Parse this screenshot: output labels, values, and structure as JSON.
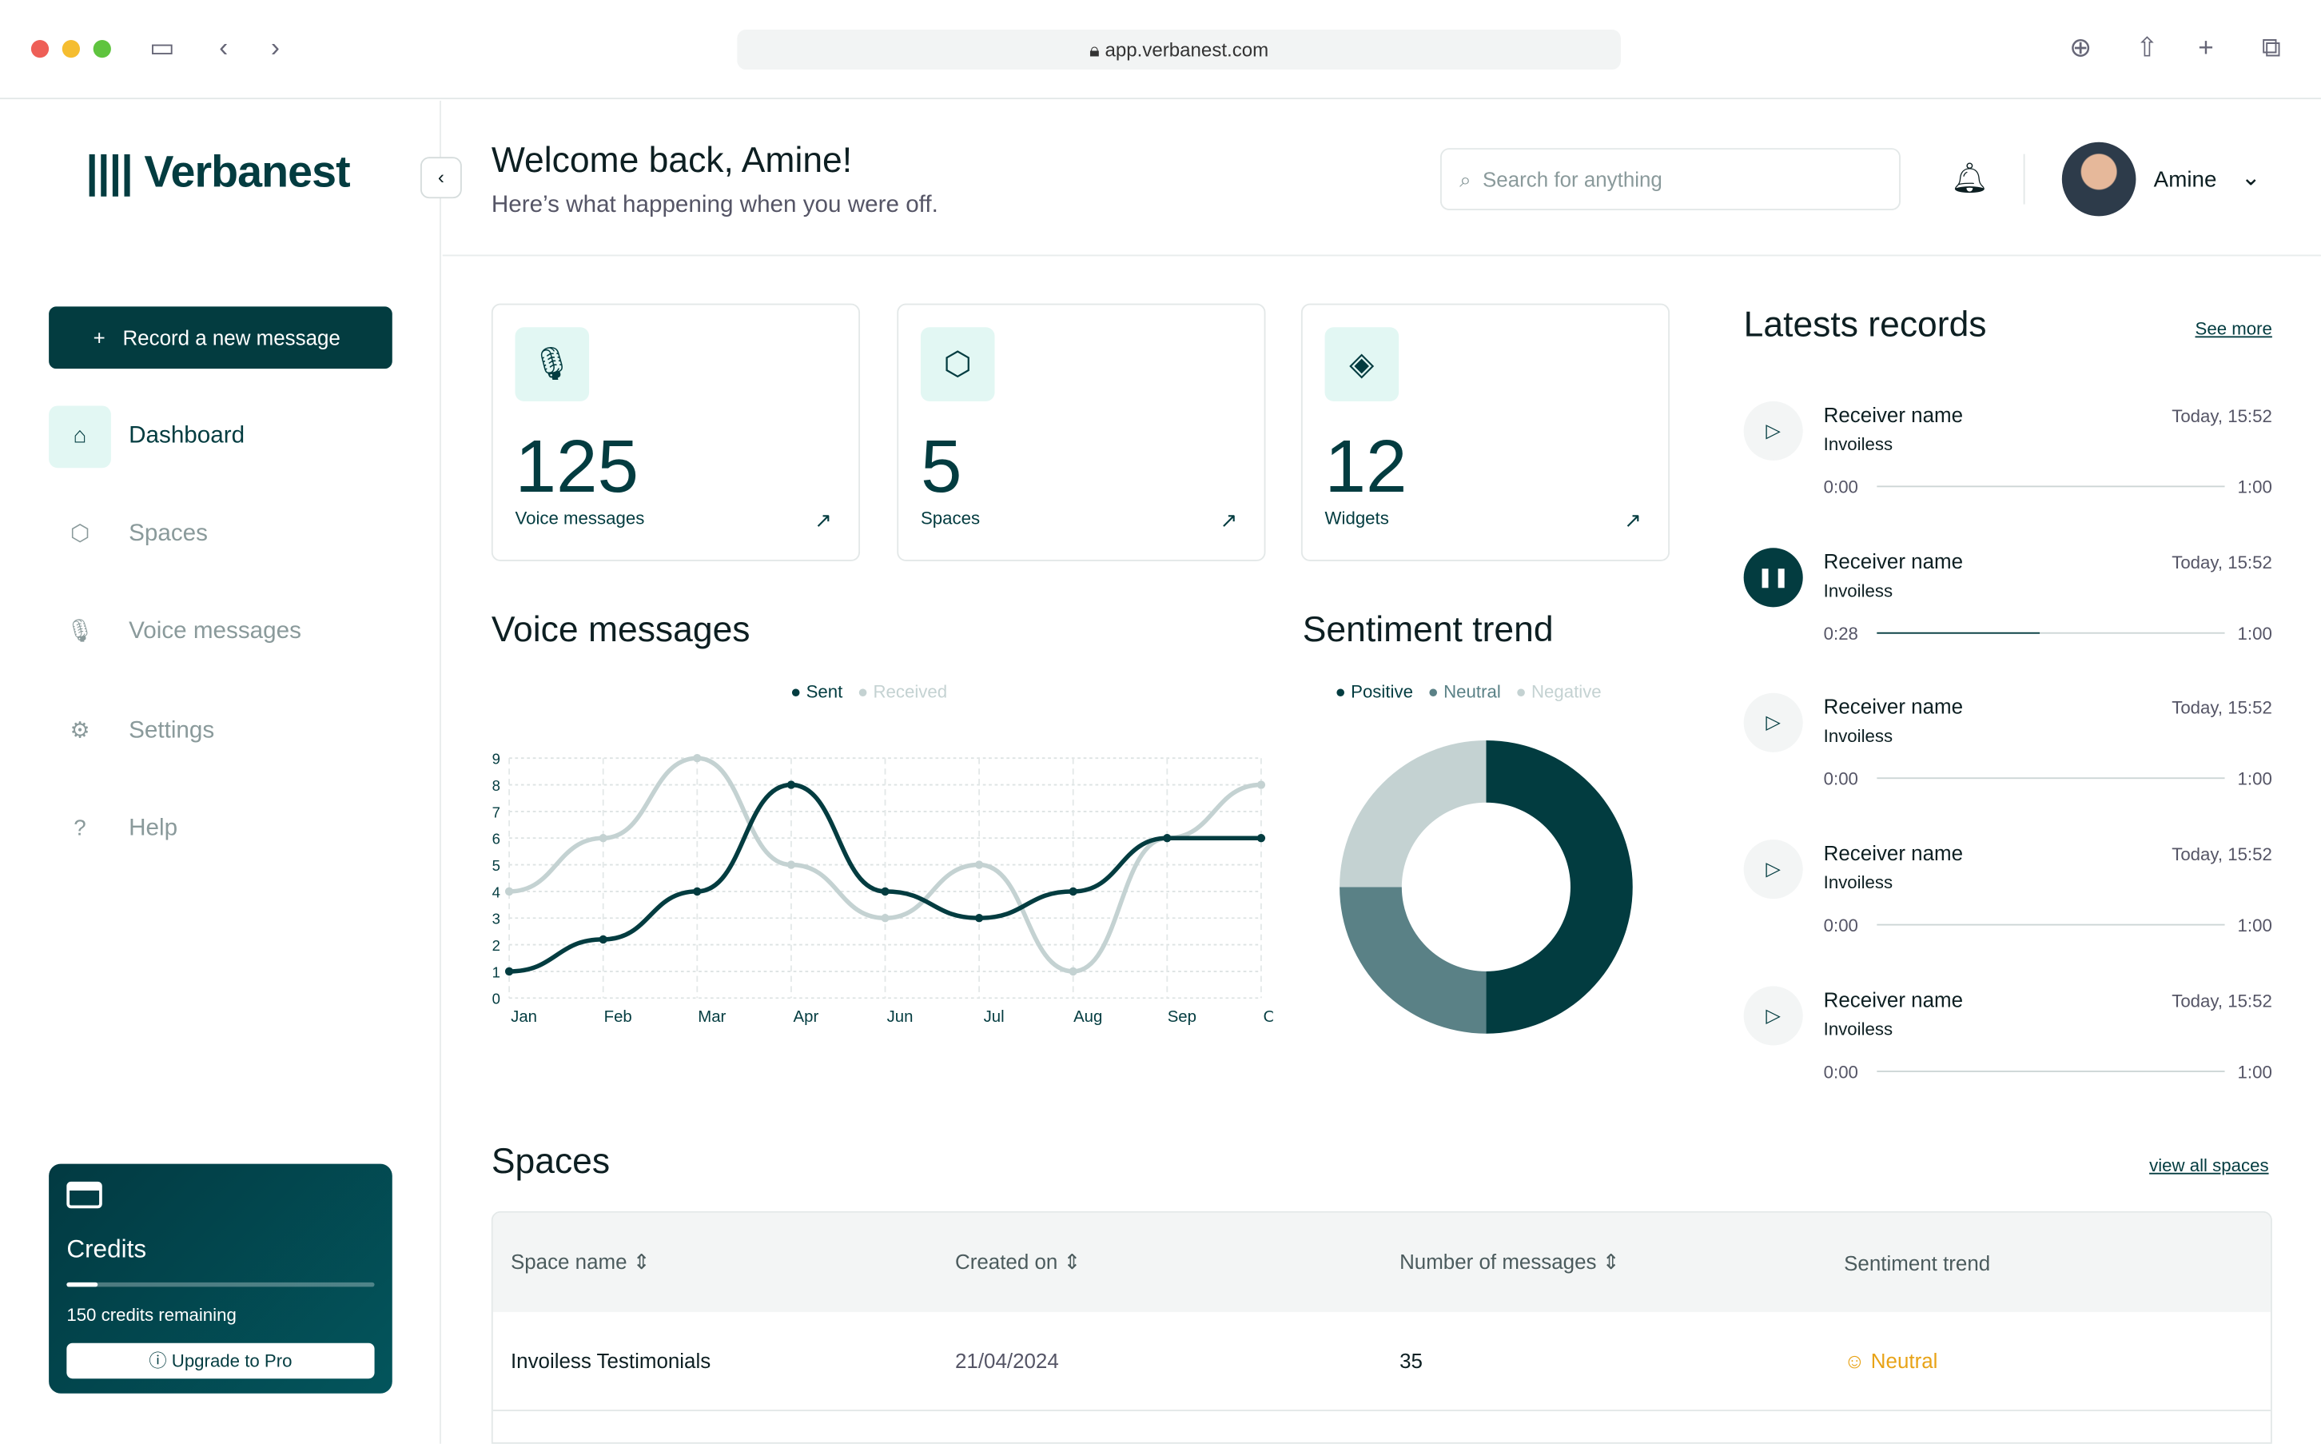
{
  "browser": {
    "url": "app.verbanest.com"
  },
  "brand": {
    "name": "Verbanest",
    "accent": "#033c40",
    "mint": "#e2f7f3"
  },
  "sidebar": {
    "record_button": "Record a new message",
    "items": [
      {
        "label": "Dashboard",
        "icon": "home-icon",
        "active": true
      },
      {
        "label": "Spaces",
        "icon": "cube-icon"
      },
      {
        "label": "Voice messages",
        "icon": "mic-icon"
      },
      {
        "label": "Settings",
        "icon": "gear-icon"
      },
      {
        "label": "Help",
        "icon": "help-icon"
      }
    ],
    "credits": {
      "title": "Credits",
      "remaining": "150 credits remaining",
      "progress_percent": 10,
      "upgrade": "Upgrade to Pro"
    }
  },
  "header": {
    "title": "Welcome back, Amine!",
    "subtitle": "Here’s what happening when you were off.",
    "search_placeholder": "Search for anything",
    "user": "Amine"
  },
  "stats": [
    {
      "value": "125",
      "label": "Voice messages",
      "icon": "mic-icon"
    },
    {
      "value": "5",
      "label": "Spaces",
      "icon": "cube-icon"
    },
    {
      "value": "12",
      "label": "Widgets",
      "icon": "layers-icon"
    }
  ],
  "chart_data": [
    {
      "type": "line",
      "title": "Voice messages",
      "categories": [
        "Jan",
        "Feb",
        "Mar",
        "Apr",
        "Jun",
        "Jul",
        "Aug",
        "Sep",
        "Oct"
      ],
      "ylim": [
        0,
        9
      ],
      "yticks": [
        "0",
        "1",
        "2",
        "3",
        "4",
        "5",
        "6",
        "7",
        "8",
        "9"
      ],
      "grid": true,
      "legend": "top",
      "series": [
        {
          "name": "Sent",
          "color": "#033c40",
          "values": [
            1,
            2.2,
            4,
            8,
            4,
            3,
            4,
            6,
            6
          ]
        },
        {
          "name": "Received",
          "color": "#c4d2d2",
          "values": [
            4,
            6,
            9,
            5,
            3,
            5,
            1,
            6,
            8
          ]
        }
      ]
    },
    {
      "type": "pie",
      "title": "Sentiment trend",
      "legend": "top",
      "labels": [
        "Positive",
        "Neutral",
        "Negative"
      ],
      "values": [
        50,
        25,
        25
      ],
      "colors": [
        "#023c40",
        "#5a8186",
        "#c4d2d2"
      ]
    }
  ],
  "records": {
    "title": "Latests records",
    "see_more": "See more",
    "items": [
      {
        "name": "Receiver name",
        "sub": "Invoiless",
        "time": "Today, 15:52",
        "pos": "0:00",
        "dur": "1:00",
        "progress": 0,
        "playing": false
      },
      {
        "name": "Receiver name",
        "sub": "Invoiless",
        "time": "Today, 15:52",
        "pos": "0:28",
        "dur": "1:00",
        "progress": 0.47,
        "playing": true
      },
      {
        "name": "Receiver name",
        "sub": "Invoiless",
        "time": "Today, 15:52",
        "pos": "0:00",
        "dur": "1:00",
        "progress": 0,
        "playing": false
      },
      {
        "name": "Receiver name",
        "sub": "Invoiless",
        "time": "Today, 15:52",
        "pos": "0:00",
        "dur": "1:00",
        "progress": 0,
        "playing": false
      },
      {
        "name": "Receiver name",
        "sub": "Invoiless",
        "time": "Today, 15:52",
        "pos": "0:00",
        "dur": "1:00",
        "progress": 0,
        "playing": false
      }
    ]
  },
  "spaces": {
    "title": "Spaces",
    "view_all": "view all spaces",
    "columns": [
      "Space name",
      "Created on",
      "Number of messages",
      "Sentiment trend"
    ],
    "rows": [
      {
        "name": "Invoiless Testimonials",
        "created": "21/04/2024",
        "messages": "35",
        "sentiment": "Neutral",
        "sentiment_color": "#e8a317"
      }
    ]
  }
}
